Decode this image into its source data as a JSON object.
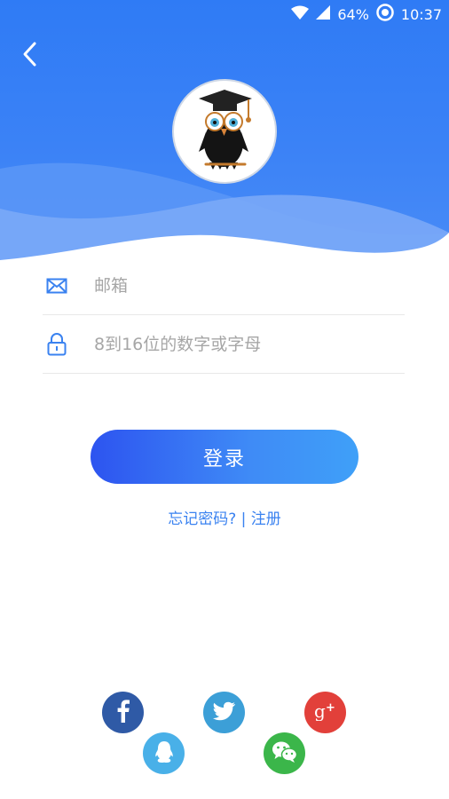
{
  "status_bar": {
    "battery": "64%",
    "time": "10:37"
  },
  "login": {
    "email_placeholder": "邮箱",
    "password_placeholder": "8到16位的数字或字母",
    "submit_label": "登录",
    "forgot_label": "忘记密码?",
    "separator": "|",
    "register_label": "注册"
  },
  "social_buttons": [
    "facebook",
    "twitter",
    "google-plus",
    "qq",
    "wechat"
  ],
  "colors": {
    "primary": "#3b82f6",
    "facebook": "#2f5aa6",
    "twitter": "#3c9fd7",
    "google_plus": "#e2403a",
    "qq": "#49b0e8",
    "wechat": "#3bb64a"
  }
}
